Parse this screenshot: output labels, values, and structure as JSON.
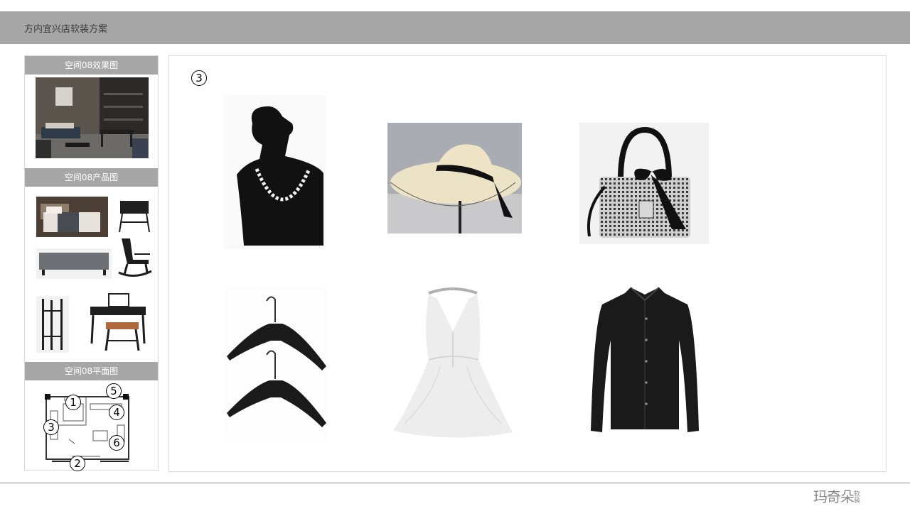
{
  "header": {
    "title": "方内宜兴店软装方案"
  },
  "sidebar": {
    "sections": [
      {
        "label": "空间08效果图"
      },
      {
        "label": "空间08产品图"
      },
      {
        "label": "空间08平面图"
      }
    ],
    "plan_markers": [
      "1",
      "2",
      "3",
      "4",
      "5",
      "6"
    ]
  },
  "main": {
    "marker": "3",
    "items": [
      {
        "icon": "necklace-bust-image"
      },
      {
        "icon": "straw-hat-image"
      },
      {
        "icon": "tweed-handbag-image"
      },
      {
        "icon": "hangers-image"
      },
      {
        "icon": "white-dress-image"
      },
      {
        "icon": "black-shirt-image"
      }
    ]
  },
  "footer": {
    "logo_main": "玛奇朵",
    "logo_small": "软装"
  },
  "colors": {
    "header_bg": "#a6a6a6",
    "section_bg": "#a6a6a6",
    "border": "#d9d9d9"
  }
}
